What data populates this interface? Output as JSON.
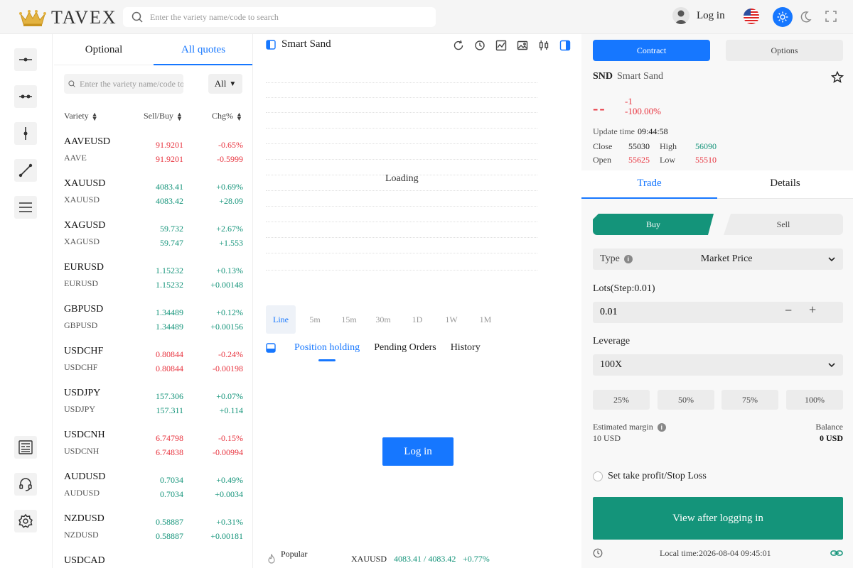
{
  "header": {
    "logo_text": "TAVEX",
    "search_placeholder": "Enter the variety name/code to search",
    "login_label": "Log in"
  },
  "quotes": {
    "tabs": [
      "Optional",
      "All quotes"
    ],
    "active_tab": 1,
    "search_placeholder": "Enter the variety name/code to search",
    "filter_label": "All",
    "columns": [
      "Variety",
      "Sell/Buy",
      "Chg%"
    ],
    "rows": [
      {
        "symbol": "AAVEUSD",
        "sub": "AAVE",
        "sell": "91.9201",
        "buy": "91.9201",
        "chg_pct": "-0.65%",
        "chg": "-0.5999",
        "dir": "down"
      },
      {
        "symbol": "XAUUSD",
        "sub": "XAUUSD",
        "sell": "4083.41",
        "buy": "4083.42",
        "chg_pct": "+0.69%",
        "chg": "+28.09",
        "dir": "up"
      },
      {
        "symbol": "XAGUSD",
        "sub": "XAGUSD",
        "sell": "59.732",
        "buy": "59.747",
        "chg_pct": "+2.67%",
        "chg": "+1.553",
        "dir": "up"
      },
      {
        "symbol": "EURUSD",
        "sub": "EURUSD",
        "sell": "1.15232",
        "buy": "1.15232",
        "chg_pct": "+0.13%",
        "chg": "+0.00148",
        "dir": "up"
      },
      {
        "symbol": "GBPUSD",
        "sub": "GBPUSD",
        "sell": "1.34489",
        "buy": "1.34489",
        "chg_pct": "+0.12%",
        "chg": "+0.00156",
        "dir": "up"
      },
      {
        "symbol": "USDCHF",
        "sub": "USDCHF",
        "sell": "0.80844",
        "buy": "0.80844",
        "chg_pct": "-0.24%",
        "chg": "-0.00198",
        "dir": "down"
      },
      {
        "symbol": "USDJPY",
        "sub": "USDJPY",
        "sell": "157.306",
        "buy": "157.311",
        "chg_pct": "+0.07%",
        "chg": "+0.114",
        "dir": "up"
      },
      {
        "symbol": "USDCNH",
        "sub": "USDCNH",
        "sell": "6.74798",
        "buy": "6.74838",
        "chg_pct": "-0.15%",
        "chg": "-0.00994",
        "dir": "down"
      },
      {
        "symbol": "AUDUSD",
        "sub": "AUDUSD",
        "sell": "0.7034",
        "buy": "0.7034",
        "chg_pct": "+0.49%",
        "chg": "+0.0034",
        "dir": "up"
      },
      {
        "symbol": "NZDUSD",
        "sub": "NZDUSD",
        "sell": "0.58887",
        "buy": "0.58887",
        "chg_pct": "+0.31%",
        "chg": "+0.00181",
        "dir": "up"
      },
      {
        "symbol": "USDCAD",
        "sub": "",
        "sell": "",
        "buy": "",
        "chg_pct": "",
        "chg": "",
        "dir": "up"
      }
    ]
  },
  "chart": {
    "title": "Smart Sand",
    "loading_text": "Loading",
    "periods": [
      "Line",
      "5m",
      "15m",
      "30m",
      "1D",
      "1W",
      "1M"
    ],
    "active_period": 0,
    "position_tabs": [
      "Position holding",
      "Pending Orders",
      "History"
    ],
    "login_button": "Log in",
    "popular_label": "Popular",
    "popular_symbol": "XAUUSD",
    "popular_price": "4083.41 / 4083.42",
    "popular_change": "+0.77%"
  },
  "trade_panel": {
    "contract_tab": "Contract",
    "options_tab": "Options",
    "symbol_code": "SND",
    "symbol_name": "Smart Sand",
    "price": "--",
    "change": "-1",
    "change_pct": "-100.00%",
    "update_label": "Update time",
    "update_time": "09:44:58",
    "close_label": "Close",
    "close_value": "55030",
    "high_label": "High",
    "high_value": "56090",
    "open_label": "Open",
    "open_value": "55625",
    "low_label": "Low",
    "low_value": "55510",
    "tabs": [
      "Trade",
      "Details"
    ],
    "buy_label": "Buy",
    "sell_label": "Sell",
    "type_label": "Type",
    "type_value": "Market Price",
    "lots_label": "Lots(Step:0.01)",
    "lots_value": "0.01",
    "leverage_label": "Leverage",
    "leverage_value": "100X",
    "percent_buttons": [
      "25%",
      "50%",
      "75%",
      "100%"
    ],
    "margin_label": "Estimated margin",
    "margin_value": "10 USD",
    "balance_label": "Balance",
    "balance_value": "0 USD",
    "tpsl_label": "Set take profit/Stop Loss",
    "view_button": "View after logging in",
    "local_time": "Local time:2026-08-04 09:45:01"
  },
  "colors": {
    "accent": "#1677ff",
    "up": "#14947a",
    "down": "#e8343f"
  }
}
